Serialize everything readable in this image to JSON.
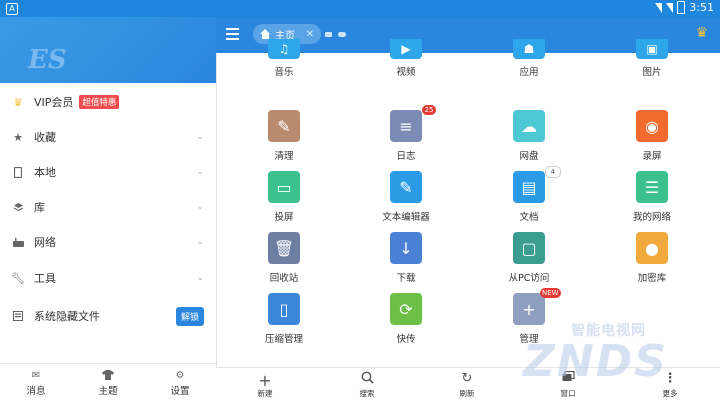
{
  "status_bar": {
    "time": "3:51"
  },
  "drawer": {
    "header_logo": "ES",
    "vip": {
      "label": "VIP会员",
      "badge": "超值特惠"
    },
    "items": [
      {
        "label": "收藏",
        "icon": "star-icon"
      },
      {
        "label": "本地",
        "icon": "phone-icon"
      },
      {
        "label": "库",
        "icon": "layers-icon"
      },
      {
        "label": "网络",
        "icon": "network-icon"
      },
      {
        "label": "工具",
        "icon": "wrench-icon"
      }
    ],
    "hidden_files": {
      "label": "系统隐藏文件",
      "button": "解锁"
    },
    "bottom": [
      {
        "label": "消息",
        "icon": "message-icon"
      },
      {
        "label": "主题",
        "icon": "shirt-icon"
      },
      {
        "label": "设置",
        "icon": "gear-icon"
      }
    ]
  },
  "topbar": {
    "tab_label": "主页"
  },
  "grid": [
    {
      "label": "音乐",
      "icon": "music-icon",
      "color": "#2ea7ea"
    },
    {
      "label": "视频",
      "icon": "video-icon",
      "color": "#2ea7ea"
    },
    {
      "label": "应用",
      "icon": "android-icon",
      "color": "#2ea7ea"
    },
    {
      "label": "图片",
      "icon": "image-icon",
      "color": "#2ea7ea"
    },
    {
      "label": "清理",
      "icon": "broom-icon",
      "color": "#b88a6e"
    },
    {
      "label": "日志",
      "icon": "log-icon",
      "color": "#7b8bb4",
      "badge": "25"
    },
    {
      "label": "网盘",
      "icon": "cloud-icon",
      "color": "#4ec8d3"
    },
    {
      "label": "录屏",
      "icon": "record-icon",
      "color": "#f26b2e"
    },
    {
      "label": "投屏",
      "icon": "cast-icon",
      "color": "#3cc08f"
    },
    {
      "label": "文本编辑器",
      "icon": "edit-icon",
      "color": "#2c9be6"
    },
    {
      "label": "文档",
      "icon": "document-icon",
      "color": "#2c9be6",
      "badge": "4"
    },
    {
      "label": "我的网络",
      "icon": "router-icon",
      "color": "#3cc08f"
    },
    {
      "label": "回收站",
      "icon": "trash-icon",
      "color": "#6d7ea3"
    },
    {
      "label": "下载",
      "icon": "download-icon",
      "color": "#4a80d6"
    },
    {
      "label": "从PC访问",
      "icon": "pc-icon",
      "color": "#3b9c90"
    },
    {
      "label": "加密库",
      "icon": "lock-icon",
      "color": "#f2a93b"
    },
    {
      "label": "压缩管理",
      "icon": "zip-icon",
      "color": "#3b86d8"
    },
    {
      "label": "快传",
      "icon": "transfer-icon",
      "color": "#6cc046"
    },
    {
      "label": "管理",
      "icon": "plus-icon",
      "color": "#8f9fc0",
      "badge": "NEW"
    }
  ],
  "toolbar": [
    {
      "label": "新建",
      "icon": "plus-icon"
    },
    {
      "label": "搜索",
      "icon": "search-icon"
    },
    {
      "label": "刷新",
      "icon": "refresh-icon"
    },
    {
      "label": "窗口",
      "icon": "windows-icon"
    },
    {
      "label": "更多",
      "icon": "more-icon"
    }
  ],
  "watermark": {
    "main": "ZNDS",
    "sub": "智能电视网"
  }
}
